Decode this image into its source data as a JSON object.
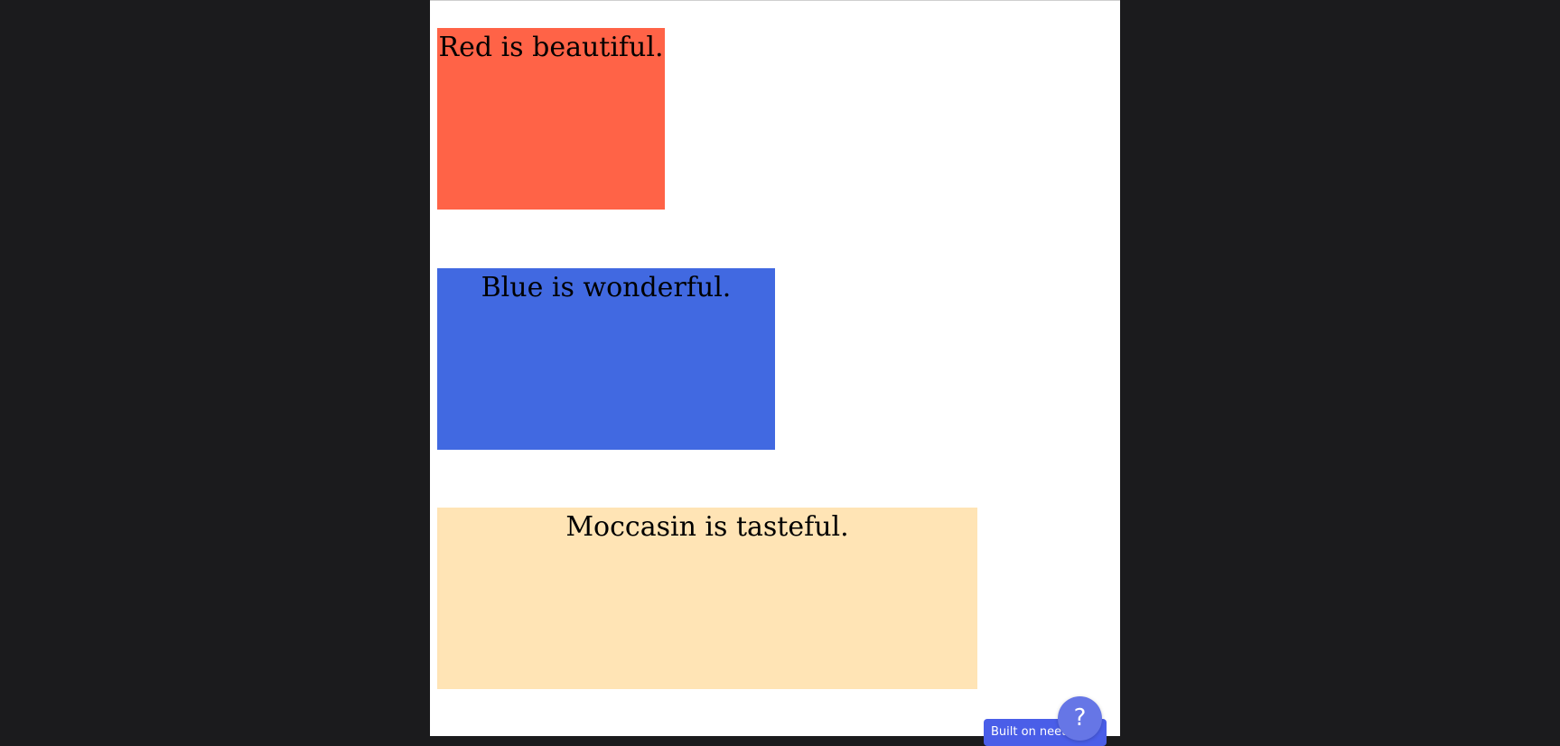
{
  "colors": {
    "background": "#1b1b1d",
    "page": "#ffffff",
    "red": "#ff6347",
    "blue": "#4169e1",
    "moccasin": "#ffe4b5",
    "badge": "#4a5ee8",
    "help": "#6676e6"
  },
  "blocks": [
    {
      "text": "Red is beautiful."
    },
    {
      "text": "Blue is wonderful."
    },
    {
      "text": "Moccasin is tasteful."
    }
  ],
  "footer": {
    "badge_label": "Built on neetcode",
    "help_label": "?",
    "help_icon": "question-mark-icon"
  }
}
